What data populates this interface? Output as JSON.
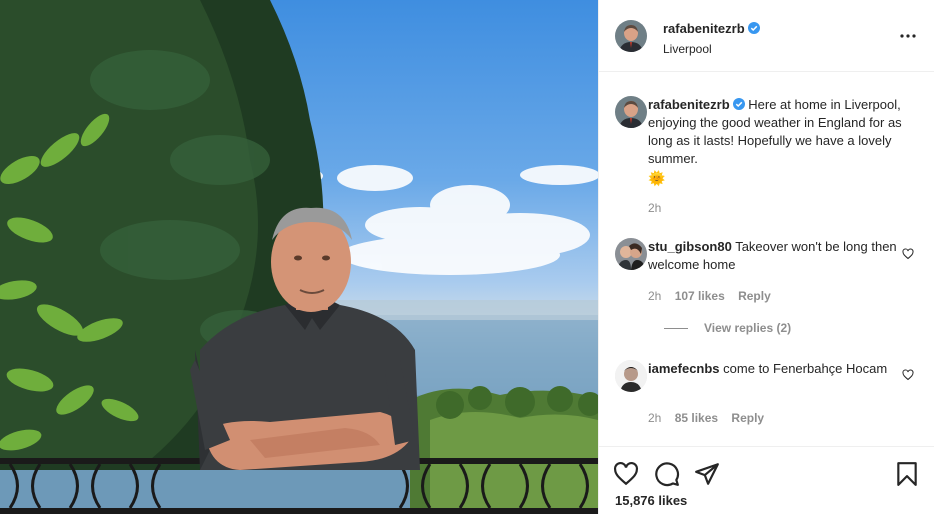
{
  "post": {
    "author": {
      "username": "rafabenitezrb",
      "location": "Liverpool",
      "avatar_icon": "profile-photo",
      "verified": true
    },
    "caption": {
      "text": "Here at home in Liverpool, enjoying the good weather in England for as long as it lasts! Hopefully we have a lovely summer.",
      "emoji": "🌞",
      "time": "2h"
    },
    "comments": [
      {
        "username": "stu_gibson80",
        "text": "Takeover won't be long then welcome home",
        "time": "2h",
        "likes": "107 likes",
        "reply_label": "Reply",
        "view_replies": "View replies (2)"
      },
      {
        "username": "iamefecnbs",
        "text": "come to Fenerbahçe Hocam",
        "time": "2h",
        "likes": "85 likes",
        "reply_label": "Reply"
      }
    ],
    "likes_count": "15,876 likes",
    "icons": {
      "more": "more-options-icon",
      "like": "heart-icon",
      "comment": "comment-bubble-icon",
      "share": "paper-plane-icon",
      "save": "bookmark-icon",
      "verified": "verified-badge-icon"
    },
    "colors": {
      "verified_blue": "#3897f0",
      "muted": "#8e8e8e",
      "text": "#262626"
    }
  }
}
